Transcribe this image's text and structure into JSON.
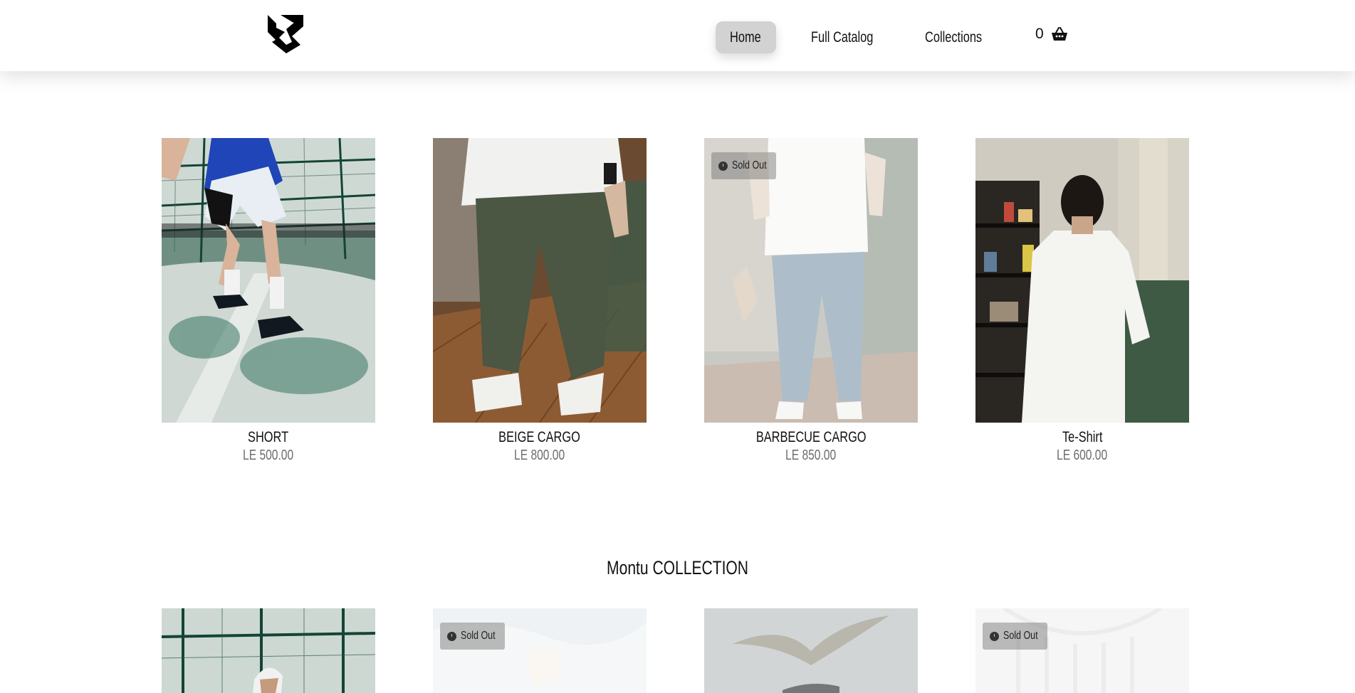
{
  "header": {
    "logo_icon": "brand-logo-icon",
    "nav": {
      "home": "Home",
      "catalog": "Full Catalog",
      "collections": "Collections"
    },
    "cart": {
      "count": "0",
      "icon": "basket-icon"
    }
  },
  "products": [
    {
      "title": "SHORT",
      "price": "LE 500.00",
      "sold_out": false
    },
    {
      "title": "BEIGE CARGO",
      "price": "LE 800.00",
      "sold_out": false
    },
    {
      "title": "BARBECUE CARGO",
      "price": "LE 850.00",
      "sold_out": true,
      "badge": "Sold Out"
    },
    {
      "title": "Te-Shirt",
      "price": "LE 600.00",
      "sold_out": false
    }
  ],
  "collection": {
    "title": "Montu COLLECTION",
    "items": [
      {
        "sold_out": false
      },
      {
        "sold_out": true,
        "badge": "Sold Out"
      },
      {
        "sold_out": false
      },
      {
        "sold_out": true,
        "badge": "Sold Out"
      }
    ]
  },
  "colors": {
    "accent_nav_active": "#d2d2d2",
    "price_text": "#6d6d6d",
    "text": "#111111"
  }
}
